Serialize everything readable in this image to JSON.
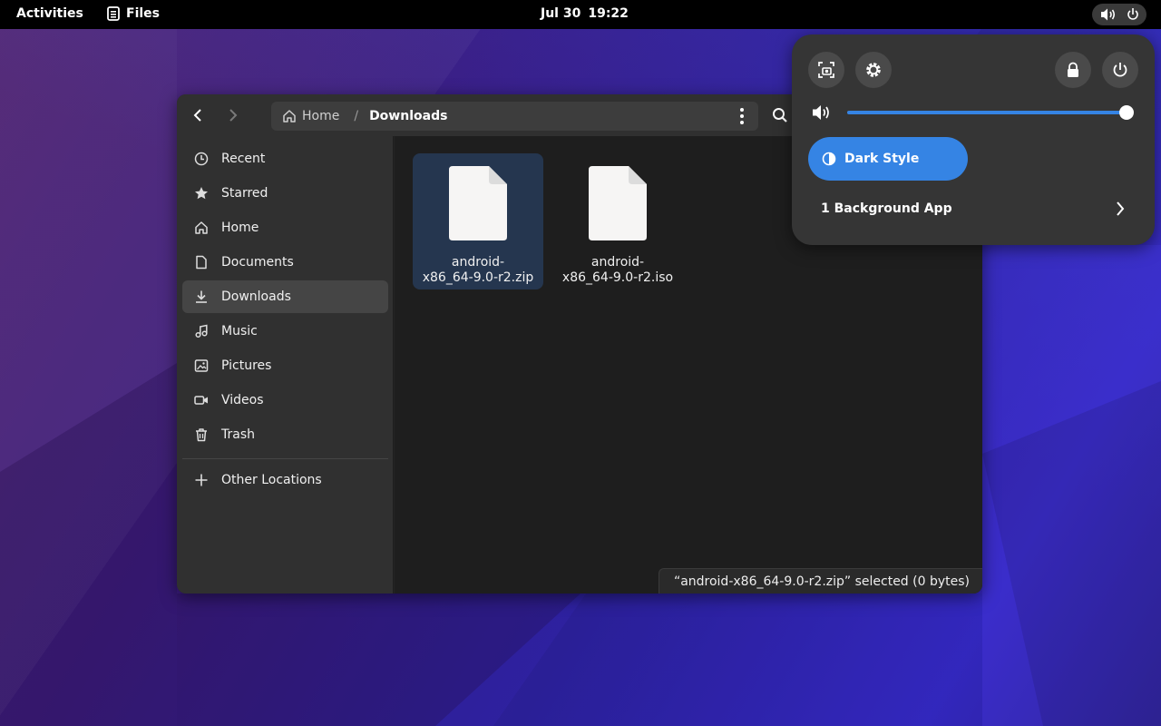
{
  "topbar": {
    "activities": "Activities",
    "app_name": "Files",
    "date": "Jul 30",
    "time": "19:22"
  },
  "window": {
    "path": {
      "home": "Home",
      "separator": "/",
      "current": "Downloads"
    },
    "sidebar": {
      "items": [
        {
          "label": "Recent",
          "icon": "clock-icon"
        },
        {
          "label": "Starred",
          "icon": "star-icon"
        },
        {
          "label": "Home",
          "icon": "home-icon"
        },
        {
          "label": "Documents",
          "icon": "document-icon"
        },
        {
          "label": "Downloads",
          "icon": "download-icon",
          "active": true
        },
        {
          "label": "Music",
          "icon": "music-icon"
        },
        {
          "label": "Pictures",
          "icon": "picture-icon"
        },
        {
          "label": "Videos",
          "icon": "video-icon"
        },
        {
          "label": "Trash",
          "icon": "trash-icon"
        }
      ],
      "other_locations": "Other Locations"
    },
    "files": [
      {
        "name_line1": "android-",
        "name_line2": "x86_64-9.0-r2.zip",
        "selected": true
      },
      {
        "name_line1": "android-",
        "name_line2": "x86_64-9.0-r2.iso",
        "selected": false
      }
    ],
    "status": "“android-x86_64-9.0-r2.zip” selected  (0 bytes)"
  },
  "quick_settings": {
    "volume_percent": 100,
    "dark_style_label": "Dark Style",
    "background_apps_label": "1 Background App"
  },
  "colors": {
    "accent": "#3584e4",
    "selection": "#25364f"
  }
}
